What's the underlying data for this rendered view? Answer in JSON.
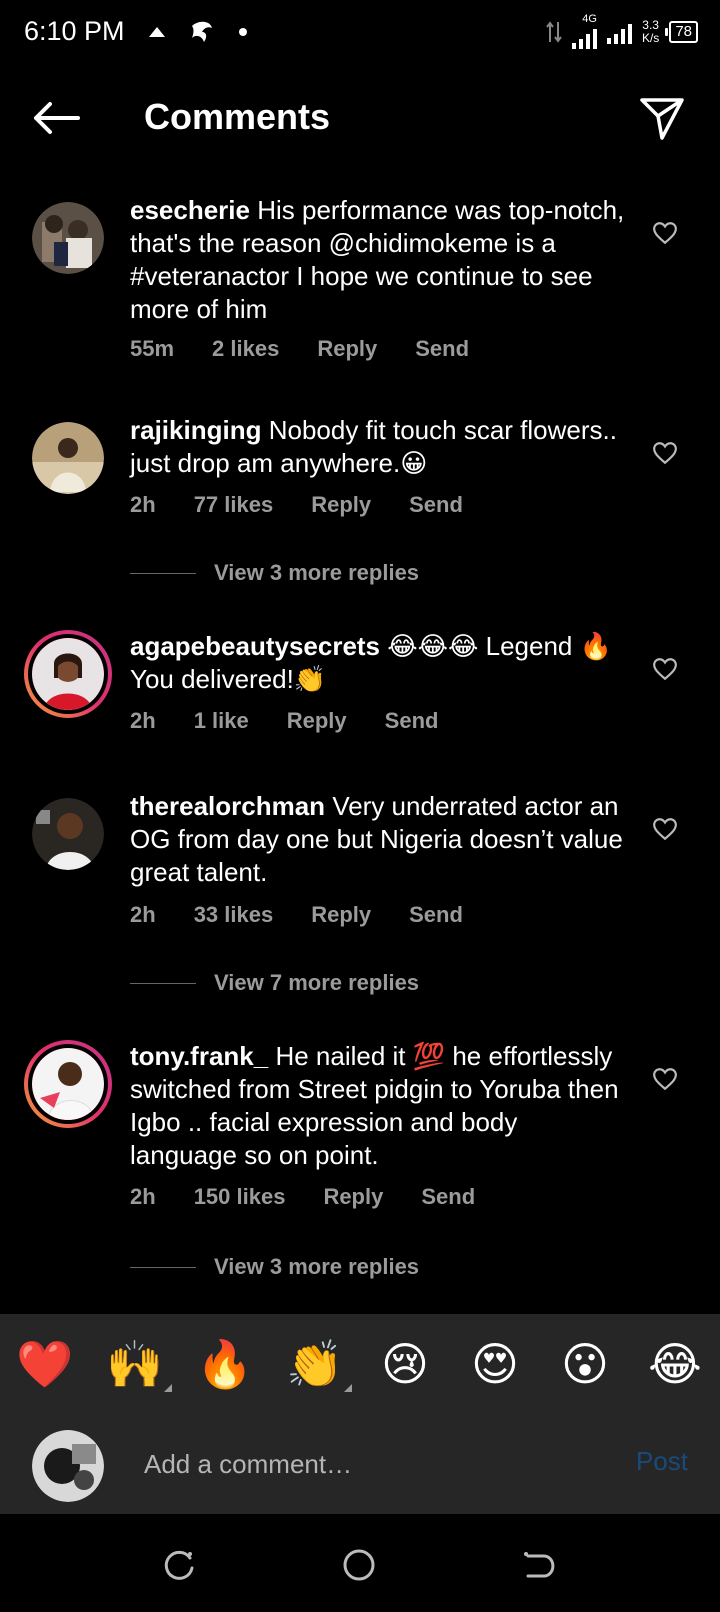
{
  "status_bar": {
    "time": "6:10 PM",
    "network": "4G",
    "speed_value": "3.3",
    "speed_unit": "K/s",
    "battery": "78"
  },
  "header": {
    "title": "Comments"
  },
  "comments": [
    {
      "username": "esecherie",
      "text": "His performance was top-notch, that's the reason @chidimokeme is a #veteranactor I hope we continue to see more of him",
      "time": "55m",
      "likes": "2 likes",
      "reply": "Reply",
      "send": "Send"
    },
    {
      "username": "rajikinging",
      "text": "Nobody fit touch scar flowers.. just drop am anywhere.😀",
      "time": "2h",
      "likes": "77 likes",
      "reply": "Reply",
      "send": "Send",
      "view_replies": "View 3 more replies"
    },
    {
      "username": "agapebeautysecrets",
      "text": "😂😂😂 Legend 🔥 You delivered!👏",
      "time": "2h",
      "likes": "1 like",
      "reply": "Reply",
      "send": "Send"
    },
    {
      "username": "therealorchman",
      "text": "Very underrated actor an OG from day one but Nigeria  doesn’t value great talent.",
      "time": "2h",
      "likes": "33 likes",
      "reply": "Reply",
      "send": "Send",
      "view_replies": "View 7 more replies"
    },
    {
      "username": "tony.frank_",
      "text": "He nailed it 💯 he effortlessly switched from Street pidgin to Yoruba then Igbo .. facial expression and body language so on point.",
      "time": "2h",
      "likes": "150 likes",
      "reply": "Reply",
      "send": "Send",
      "view_replies": "View 3 more replies"
    }
  ],
  "emoji_bar": [
    "❤️",
    "🙌",
    "🔥",
    "👏",
    "😢",
    "😍",
    "😮",
    "😂"
  ],
  "comment_input": {
    "placeholder": "Add a comment…",
    "post_label": "Post"
  },
  "colors": {
    "background": "#000000",
    "panel": "#262626",
    "muted_text": "#9b9b9b",
    "post_disabled": "#1a4a7a"
  }
}
